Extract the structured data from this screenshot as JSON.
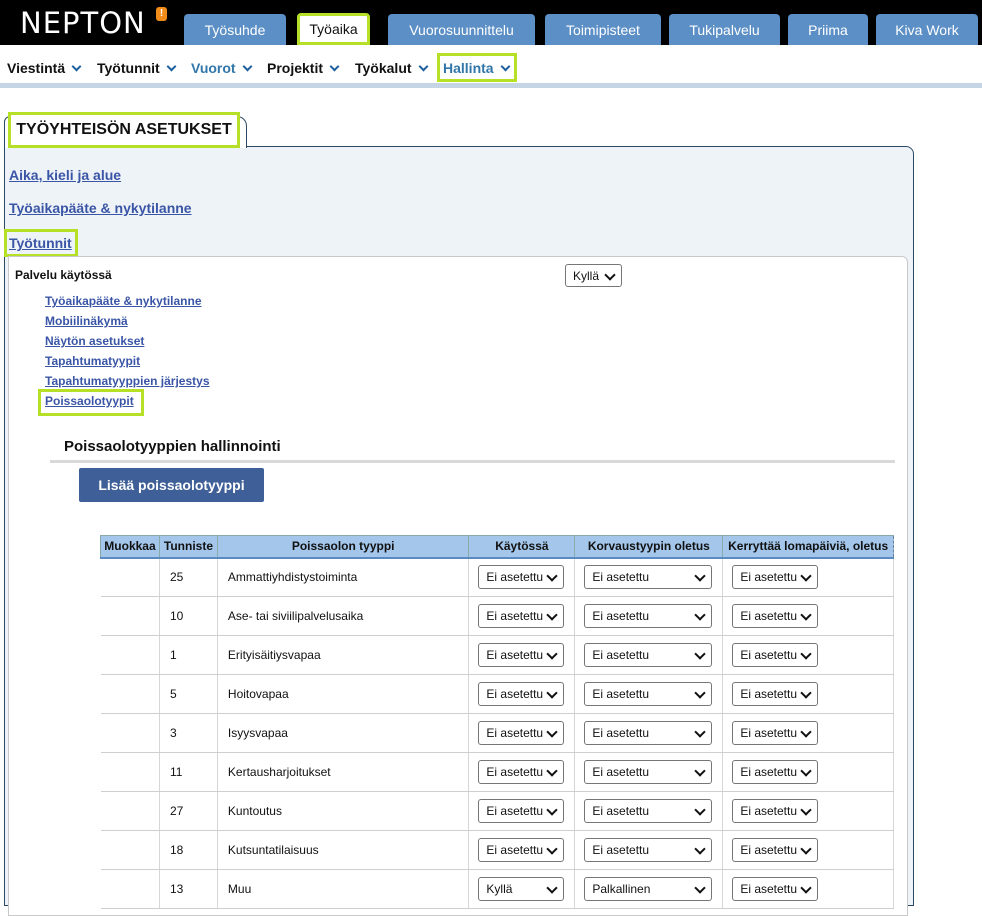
{
  "app": {
    "logo": "NEPTON"
  },
  "main_tabs": [
    {
      "label": "Työsuhde",
      "active": false
    },
    {
      "label": "Työaika",
      "active": true
    },
    {
      "label": "Vuorosuunnittelu",
      "active": false
    },
    {
      "label": "Toimipisteet",
      "active": false
    },
    {
      "label": "Tukipalvelu",
      "active": false
    },
    {
      "label": "Priima",
      "active": false
    },
    {
      "label": "Kiva Work",
      "active": false
    }
  ],
  "sub_nav": [
    {
      "label": "Viestintä"
    },
    {
      "label": "Työtunnit",
      "badge": "!"
    },
    {
      "label": "Vuorot"
    },
    {
      "label": "Projektit"
    },
    {
      "label": "Työkalut"
    },
    {
      "label": "Hallinta"
    }
  ],
  "section": {
    "title": "TYÖYHTEISÖN ASETUKSET"
  },
  "section_links": [
    "Aika, kieli ja alue",
    "Työaikapääte & nykytilanne",
    "Työtunnit"
  ],
  "service": {
    "label": "Palvelu käytössä",
    "value": "Kyllä"
  },
  "sub_links": [
    "Työaikapääte & nykytilanne",
    "Mobiilinäkymä",
    "Näytön asetukset",
    "Tapahtumatyypit",
    "Tapahtumatyyppien järjestys",
    "Poissaolotyypit"
  ],
  "management": {
    "title": "Poissaolotyyppien hallinnointi",
    "add_button": "Lisää poissaolotyyppi"
  },
  "table": {
    "headers": [
      "Muokkaa",
      "Tunniste",
      "Poissaolon tyyppi",
      "Käytössä",
      "Korvaustyypin oletus",
      "Kerryttää lomapäiviä, oletus"
    ],
    "rows": [
      {
        "id": "25",
        "type": "Ammattiyhdistystoiminta",
        "enabled": "Ei asetettu",
        "comp": "Ei asetettu",
        "accrue": "Ei asetettu"
      },
      {
        "id": "10",
        "type": "Ase- tai siviilipalvelusaika",
        "enabled": "Ei asetettu",
        "comp": "Ei asetettu",
        "accrue": "Ei asetettu"
      },
      {
        "id": "1",
        "type": "Erityisäitiysvapaa",
        "enabled": "Ei asetettu",
        "comp": "Ei asetettu",
        "accrue": "Ei asetettu"
      },
      {
        "id": "5",
        "type": "Hoitovapaa",
        "enabled": "Ei asetettu",
        "comp": "Ei asetettu",
        "accrue": "Ei asetettu"
      },
      {
        "id": "3",
        "type": "Isyysvapaa",
        "enabled": "Ei asetettu",
        "comp": "Ei asetettu",
        "accrue": "Ei asetettu"
      },
      {
        "id": "11",
        "type": "Kertausharjoitukset",
        "enabled": "Ei asetettu",
        "comp": "Ei asetettu",
        "accrue": "Ei asetettu"
      },
      {
        "id": "27",
        "type": "Kuntoutus",
        "enabled": "Ei asetettu",
        "comp": "Ei asetettu",
        "accrue": "Ei asetettu"
      },
      {
        "id": "18",
        "type": "Kutsuntatilaisuus",
        "enabled": "Ei asetettu",
        "comp": "Ei asetettu",
        "accrue": "Ei asetettu"
      },
      {
        "id": "13",
        "type": "Muu",
        "enabled": "Kyllä",
        "comp": "Palkallinen",
        "accrue": "Ei asetettu"
      }
    ]
  }
}
